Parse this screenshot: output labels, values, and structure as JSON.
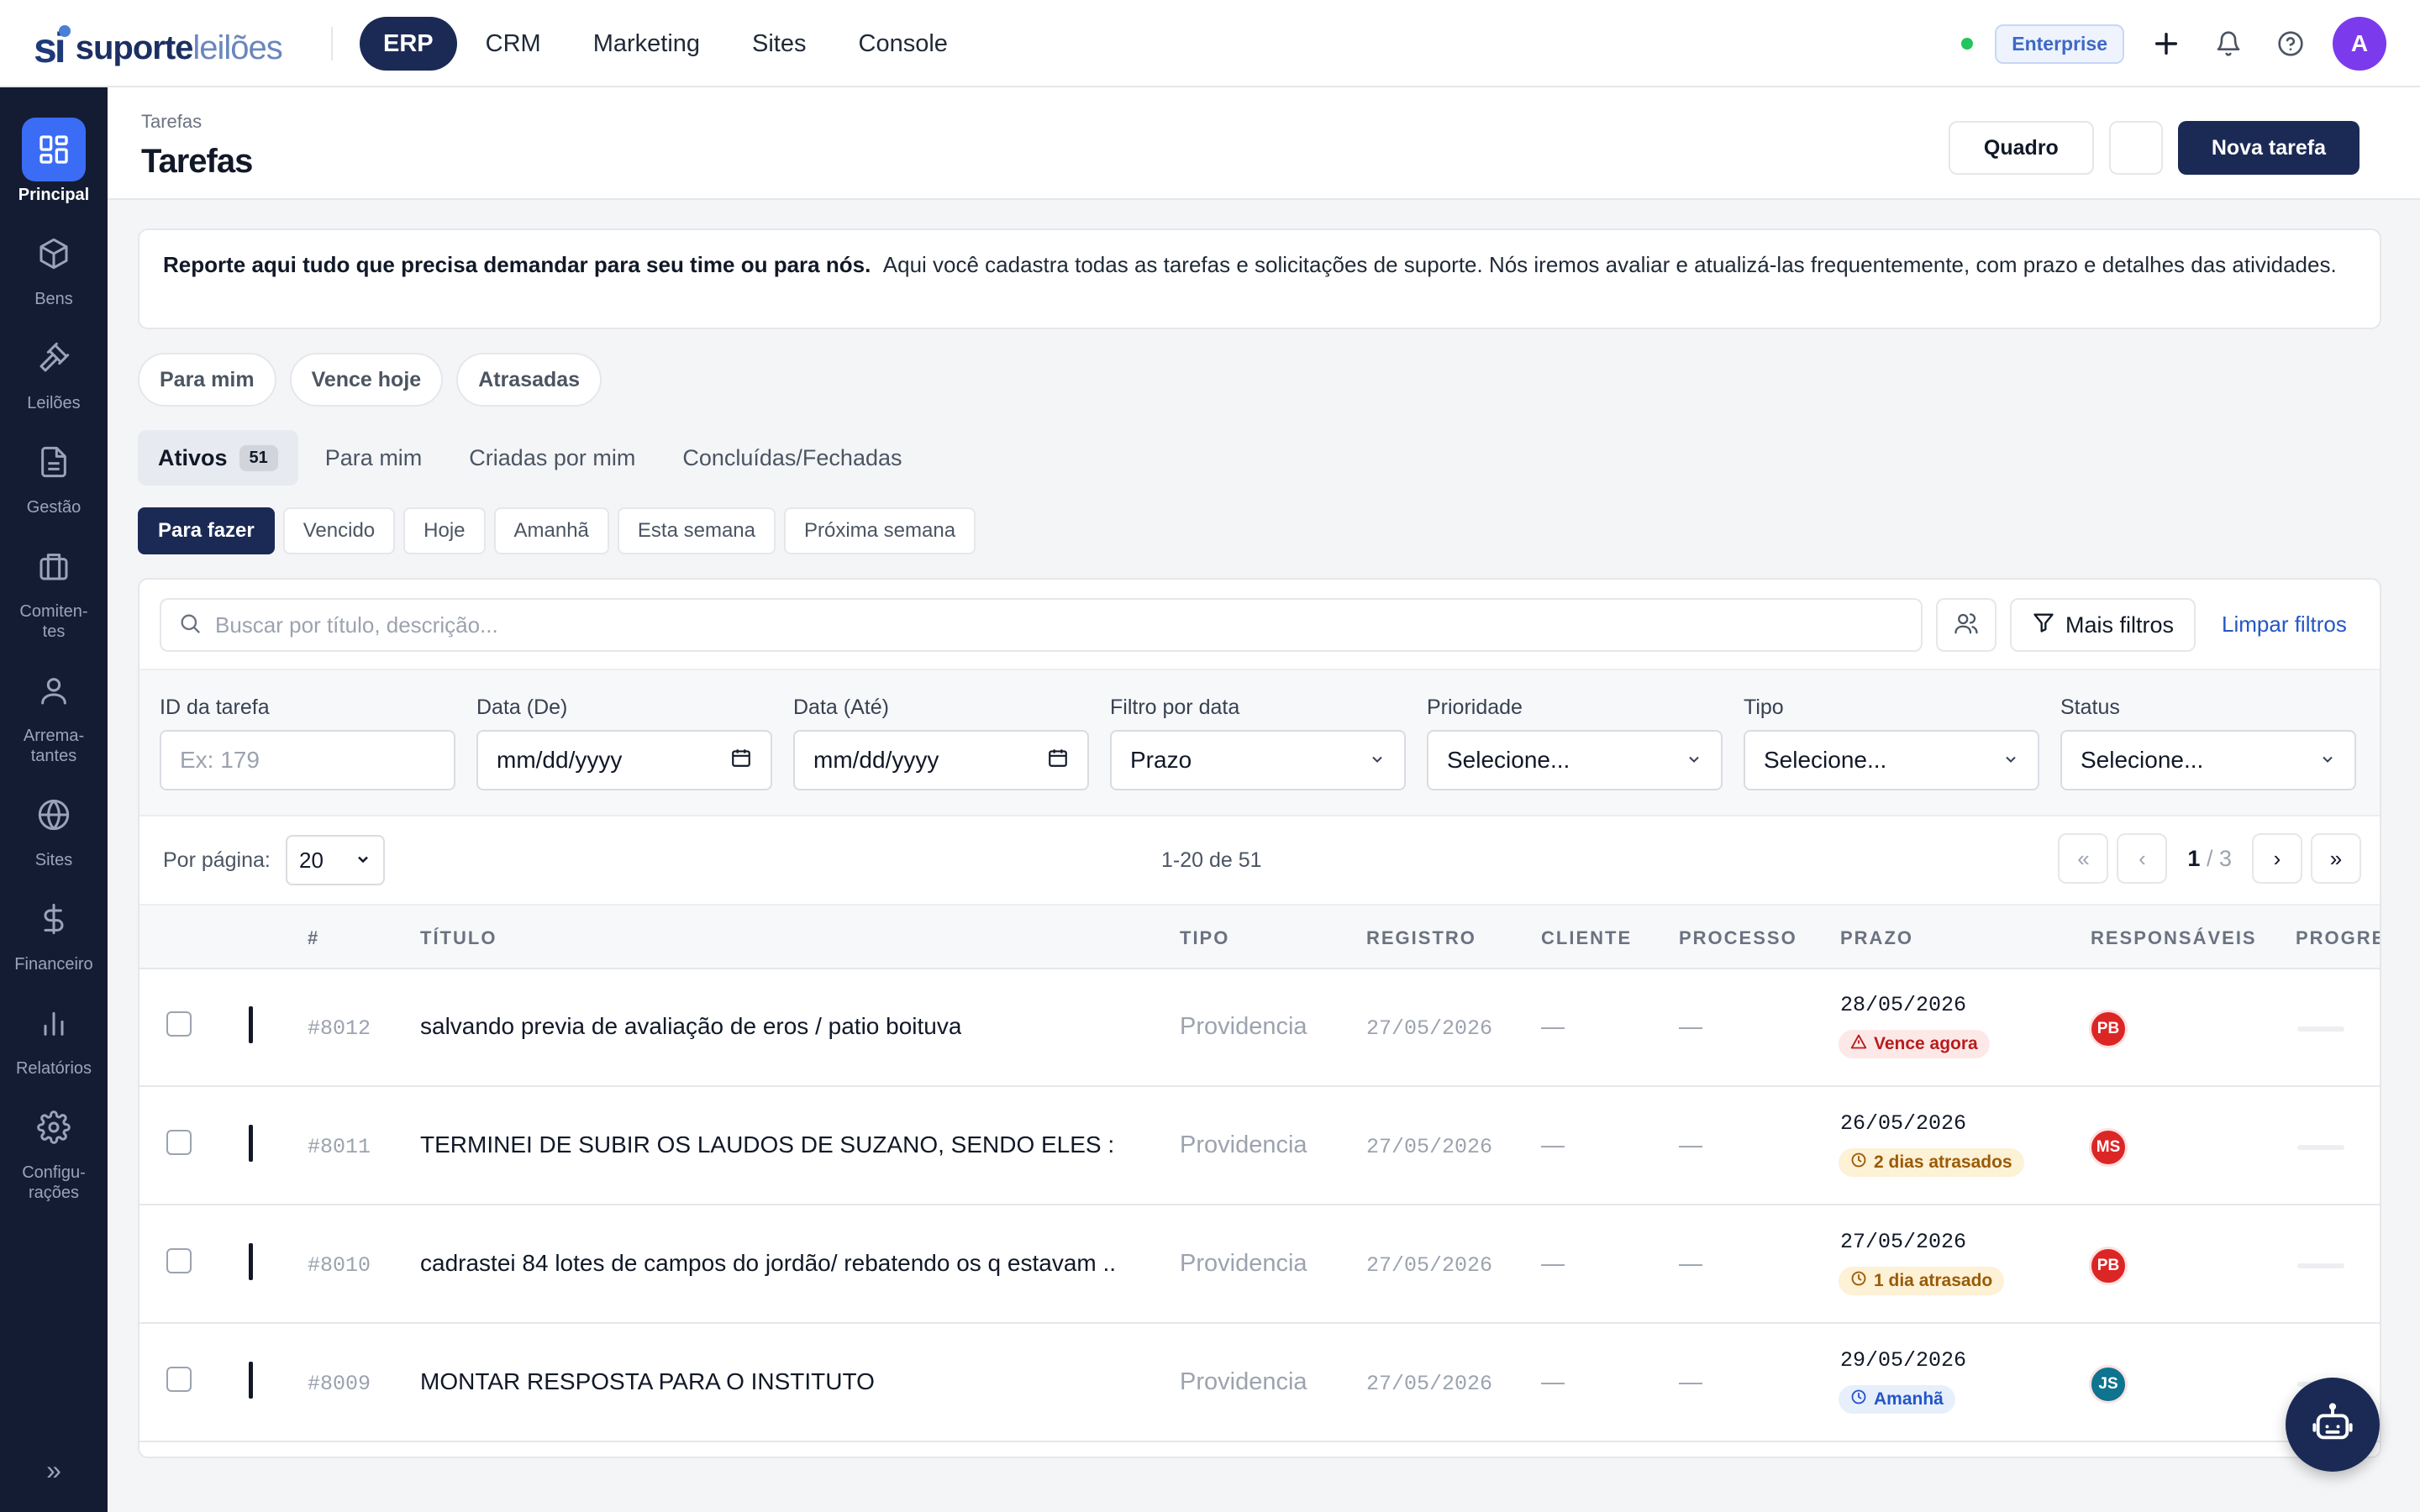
{
  "brand": {
    "mark": "si",
    "name_a": "suporte",
    "name_b": "leilões"
  },
  "nav": [
    "ERP",
    "CRM",
    "Marketing",
    "Sites",
    "Console"
  ],
  "top": {
    "plan_badge": "Enterprise",
    "avatar": "A",
    "status_color": "#22c55e",
    "accent": "#1b2a55",
    "avatar_color": "#7c3aed"
  },
  "sidebar": [
    {
      "label": "Principal",
      "icon": "grid-icon"
    },
    {
      "label": "Bens",
      "icon": "cube-icon"
    },
    {
      "label": "Leilões",
      "icon": "gavel-icon"
    },
    {
      "label": "Gestão",
      "icon": "document-icon"
    },
    {
      "label": "Comiten-tes",
      "icon": "briefcase-icon"
    },
    {
      "label": "Arrema-tantes",
      "icon": "user-icon"
    },
    {
      "label": "Sites",
      "icon": "globe-icon"
    },
    {
      "label": "Financeiro",
      "icon": "dollar-icon"
    },
    {
      "label": "Relatórios",
      "icon": "bar-chart-icon"
    },
    {
      "label": "Configu-rações",
      "icon": "gear-icon"
    }
  ],
  "header": {
    "breadcrumb": "Tarefas",
    "title": "Tarefas",
    "board_button": "Quadro",
    "new_button": "Nova tarefa"
  },
  "info": {
    "bold": "Reporte aqui tudo que precisa demandar para seu time ou para nós.",
    "text": "Aqui você cadastra todas as tarefas e solicitações de suporte. Nós iremos avaliar e atualizá-las frequentemente, com prazo e detalhes das atividades."
  },
  "quick_filters": [
    "Para mim",
    "Vence hoje",
    "Atrasadas"
  ],
  "tabs": [
    {
      "label": "Ativos",
      "count": "51"
    },
    {
      "label": "Para mim"
    },
    {
      "label": "Criadas por mim"
    },
    {
      "label": "Concluídas/Fechadas"
    }
  ],
  "period_pills": [
    "Para fazer",
    "Vencido",
    "Hoje",
    "Amanhã",
    "Esta semana",
    "Próxima semana"
  ],
  "search": {
    "placeholder": "Buscar por título, descrição...",
    "more_filters": "Mais filtros",
    "clear_filters": "Limpar filtros"
  },
  "filters": [
    {
      "label": "ID da tarefa",
      "value": "Ex: 179",
      "kind": "placeholder"
    },
    {
      "label": "Data (De)",
      "value": "mm/dd/yyyy",
      "kind": "date"
    },
    {
      "label": "Data (Até)",
      "value": "mm/dd/yyyy",
      "kind": "date"
    },
    {
      "label": "Filtro por data",
      "value": "Prazo",
      "kind": "select"
    },
    {
      "label": "Prioridade",
      "value": "Selecione...",
      "kind": "select"
    },
    {
      "label": "Tipo",
      "value": "Selecione...",
      "kind": "select"
    },
    {
      "label": "Status",
      "value": "Selecione...",
      "kind": "select"
    }
  ],
  "pagination": {
    "per_page_label": "Por página:",
    "per_page": "20",
    "range": "1-20 de 51",
    "current": "1",
    "total": "/ 3"
  },
  "columns": [
    "#",
    "TÍTULO",
    "TIPO",
    "REGISTRO",
    "CLIENTE",
    "PROCESSO",
    "PRAZO",
    "RESPONSÁVEIS",
    "PROGRES"
  ],
  "rows": [
    {
      "id": "#8012",
      "title": "salvando previa de avaliação de eros / patio boituva",
      "type": "Providencia",
      "registro": "27/05/2026",
      "cliente": "—",
      "processo": "—",
      "prazo": "28/05/2026",
      "badge": "Vence agora",
      "badge_kind": "red",
      "badge_icon": "warning-icon",
      "resp": "PB",
      "resp_color": "#dc2626"
    },
    {
      "id": "#8011",
      "title": "TERMINEI DE SUBIR OS LAUDOS DE SUZANO, SENDO ELES : APR...",
      "type": "Providencia",
      "registro": "27/05/2026",
      "cliente": "—",
      "processo": "—",
      "prazo": "26/05/2026",
      "badge": "2 dias atrasados",
      "badge_kind": "amber",
      "badge_icon": "clock-icon",
      "resp": "MS",
      "resp_color": "#dc2626"
    },
    {
      "id": "#8010",
      "title": "cadrastei 84 lotes de campos do jordão/ rebatendo os q estavam ...",
      "type": "Providencia",
      "registro": "27/05/2026",
      "cliente": "—",
      "processo": "—",
      "prazo": "27/05/2026",
      "badge": "1 dia atrasado",
      "badge_kind": "amber",
      "badge_icon": "clock-icon",
      "resp": "PB",
      "resp_color": "#dc2626"
    },
    {
      "id": "#8009",
      "title": "MONTAR RESPOSTA PARA O INSTITUTO",
      "type": "Providencia",
      "registro": "27/05/2026",
      "cliente": "—",
      "processo": "—",
      "prazo": "29/05/2026",
      "badge": "Amanhã",
      "badge_kind": "blue",
      "badge_icon": "clock-icon",
      "resp": "JS",
      "resp_color": "#0e7490"
    }
  ]
}
